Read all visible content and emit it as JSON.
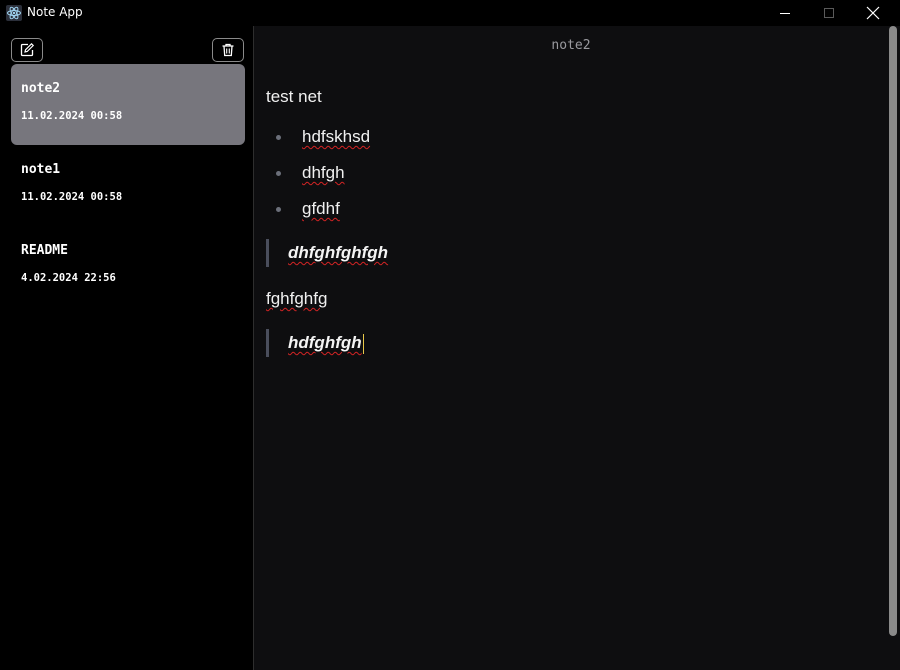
{
  "window": {
    "title": "Note App",
    "icon": "electron-atom-icon",
    "controls": [
      "minimize",
      "maximize",
      "close"
    ]
  },
  "sidebar": {
    "new_icon": "compose-icon",
    "delete_icon": "trash-icon",
    "notes": [
      {
        "title": "note2",
        "date": "11.02.2024 00:58",
        "selected": true
      },
      {
        "title": "note1",
        "date": "11.02.2024 00:58",
        "selected": false
      },
      {
        "title": "README",
        "date": "4.02.2024 22:56",
        "selected": false
      }
    ]
  },
  "editor": {
    "title": "note2",
    "paragraph1": "test net",
    "list": [
      "hdfskhsd",
      "dhfgh",
      "gfdhf"
    ],
    "quote1": "dhfghfghfgh",
    "paragraph2": "fghfghfg",
    "quote2": "hdfghfgh"
  },
  "colors": {
    "background": "#000000",
    "editor_bg": "#0e0e10",
    "selected_note": "#77767d",
    "spellcheck": "#d42424",
    "caret": "#e8c84a"
  }
}
